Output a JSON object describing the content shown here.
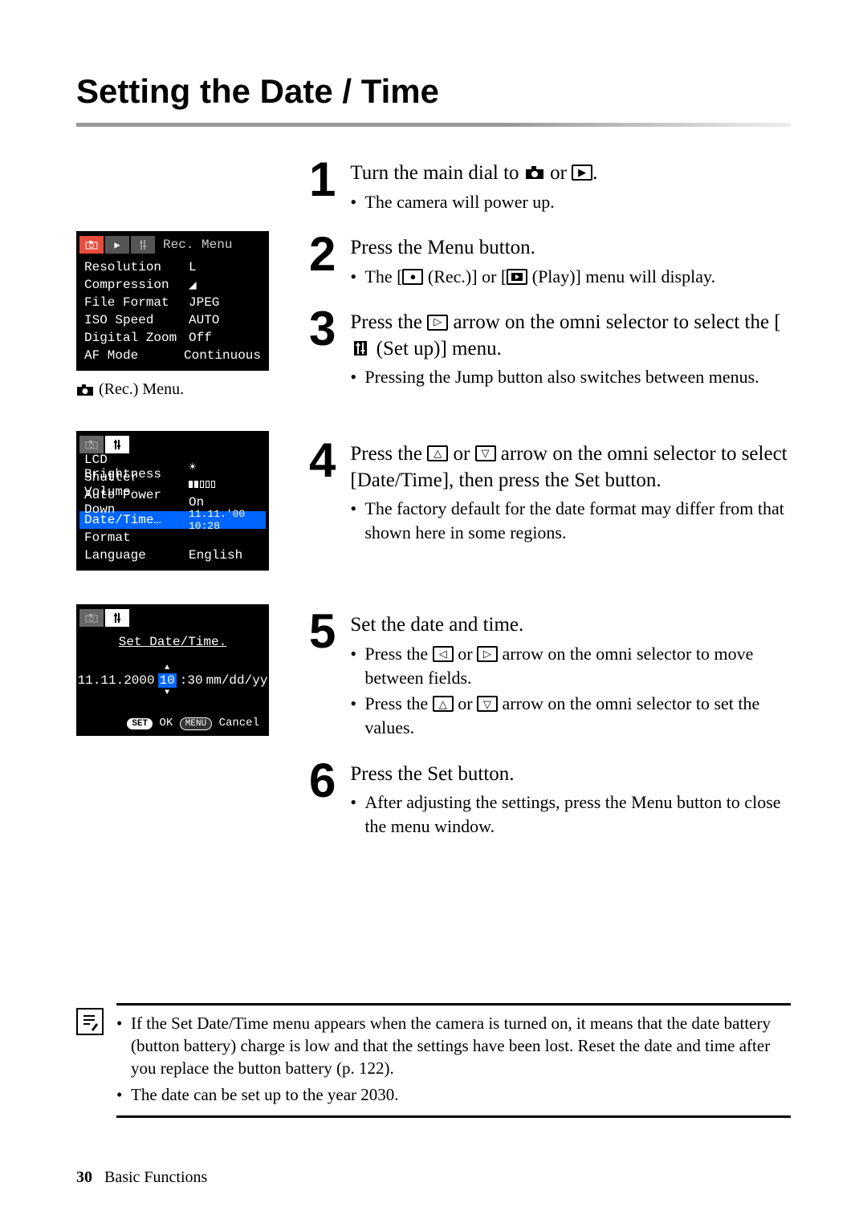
{
  "title": "Setting the Date / Time",
  "lcd_caption": "(Rec.) Menu.",
  "rec_menu": {
    "tab_label": "Rec. Menu",
    "rows": [
      {
        "label": "Resolution",
        "value": "L"
      },
      {
        "label": "Compression",
        "value": "◢"
      },
      {
        "label": "File Format",
        "value": "JPEG"
      },
      {
        "label": "ISO Speed",
        "value": "AUTO"
      },
      {
        "label": "Digital Zoom",
        "value": "Off"
      },
      {
        "label": "AF Mode",
        "value": "Continuous"
      }
    ]
  },
  "setup_menu": {
    "rows": [
      {
        "label": "LCD Brightness",
        "value": "☀",
        "selected": false
      },
      {
        "label": "Shutter Volume",
        "value": "vol",
        "selected": false
      },
      {
        "label": "Auto Power Down",
        "value": "On",
        "selected": false
      },
      {
        "label": "Date/Time…",
        "value": "11.11.'00 10:28",
        "selected": true
      },
      {
        "label": "Format",
        "value": "",
        "selected": false
      },
      {
        "label": "Language",
        "value": "English",
        "selected": false
      }
    ]
  },
  "datetime_screen": {
    "title": "Set Date/Time.",
    "date_value": "11.11.2000",
    "time_hour": "10",
    "time_rest": ":30",
    "format": "mm/dd/yy",
    "footer_set": "SET",
    "footer_ok": "OK",
    "footer_menu": "MENU",
    "footer_cancel": "Cancel"
  },
  "steps": [
    {
      "num": "1",
      "title_before": "Turn the main dial to ",
      "title_mid": " or ",
      "title_after": ".",
      "bullets": [
        "The camera will power up."
      ]
    },
    {
      "num": "2",
      "title": "Press the Menu button.",
      "bullet_before": "The [",
      "bullet_mid1": " (Rec.)] or [",
      "bullet_mid2": " (Play)] menu will display."
    },
    {
      "num": "3",
      "title_before": "Press the ",
      "title_mid": " arrow on the omni selector to select the [",
      "title_after": " (Set up)] menu.",
      "bullets": [
        "Pressing the Jump button also switches between menus."
      ]
    },
    {
      "num": "4",
      "title_before": "Press the ",
      "title_mid": " or ",
      "title_after": " arrow on the omni selector to select [Date/Time], then press the Set button.",
      "bullets": [
        "The factory default for the date format may differ from that shown here in some regions."
      ]
    },
    {
      "num": "5",
      "title": "Set the date and time.",
      "bullet1_before": "Press the ",
      "bullet1_mid": " or ",
      "bullet1_after": " arrow on the omni selector to move between fields.",
      "bullet2_before": "Press the ",
      "bullet2_mid": " or ",
      "bullet2_after": " arrow on the omni selector to set the values."
    },
    {
      "num": "6",
      "title": "Press the Set button.",
      "bullets": [
        "After adjusting the settings, press the Menu button to close the menu window."
      ]
    }
  ],
  "notes": [
    "If the Set Date/Time menu appears when the camera is turned on, it means that the date battery (button battery) charge is low and that the settings have been lost. Reset the date and time after you replace the button battery (p. 122).",
    "The date can be set up to the year 2030."
  ],
  "footer": {
    "page": "30",
    "section": "Basic Functions"
  }
}
